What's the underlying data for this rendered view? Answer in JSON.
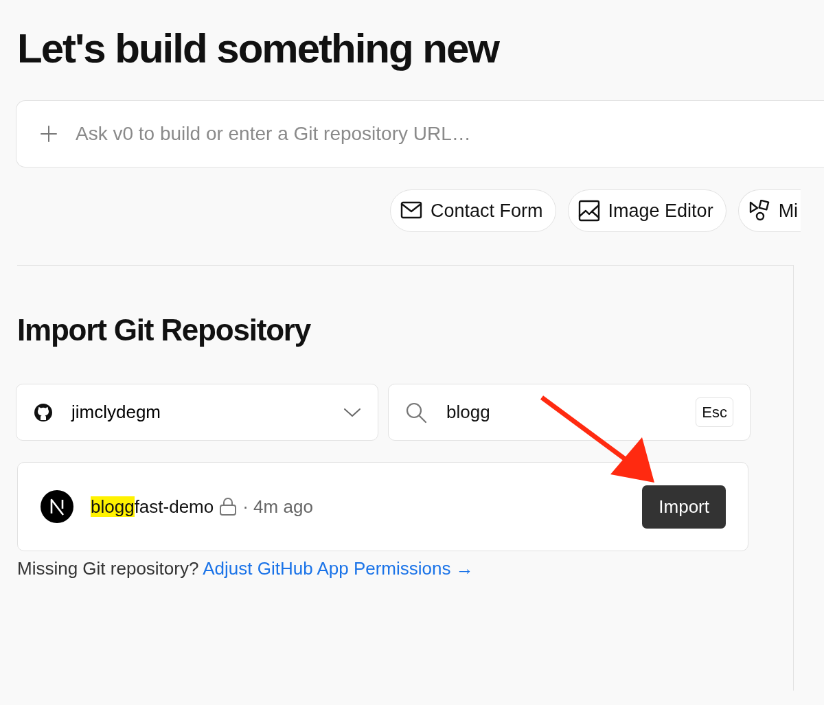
{
  "heading": "Let's build something new",
  "prompt": {
    "placeholder": "Ask v0 to build or enter a Git repository URL…"
  },
  "suggestions": [
    {
      "kind": "mail",
      "label": "Contact Form"
    },
    {
      "kind": "image",
      "label": "Image Editor"
    },
    {
      "kind": "shapes",
      "label": "Mi"
    }
  ],
  "import": {
    "title": "Import Git Repository",
    "account": "jimclydegm",
    "search": {
      "value": "blogg",
      "key_hint": "Esc"
    },
    "repos": [
      {
        "name_match": "blogg",
        "name_rest": "fast-demo",
        "private": true,
        "time": "· 4m ago",
        "button": "Import"
      }
    ],
    "missing": {
      "text": "Missing Git repository?",
      "link": "Adjust GitHub App Permissions →"
    }
  }
}
